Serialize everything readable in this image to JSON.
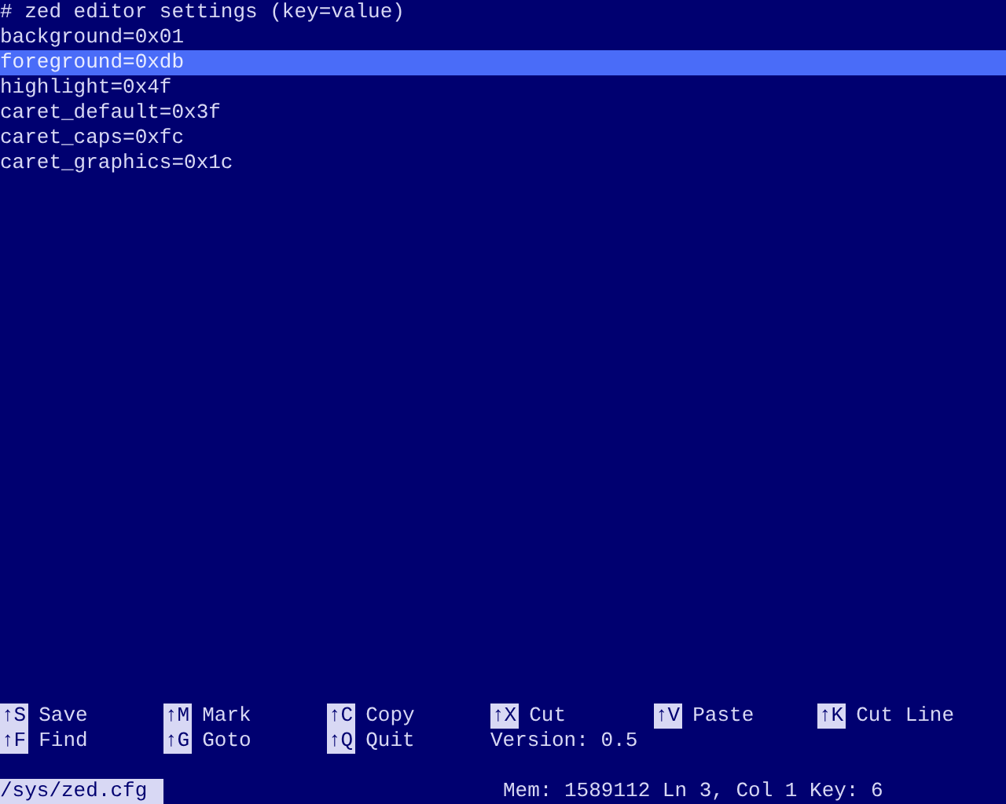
{
  "editor": {
    "lines": [
      {
        "text": "# zed editor settings (key=value)",
        "selected": false
      },
      {
        "text": "background=0x01",
        "selected": false
      },
      {
        "text": "foreground=0xdb",
        "selected": true
      },
      {
        "text": "highlight=0x4f",
        "selected": false
      },
      {
        "text": "caret_default=0x3f",
        "selected": false
      },
      {
        "text": "caret_caps=0xfc",
        "selected": false
      },
      {
        "text": "caret_graphics=0x1c",
        "selected": false
      }
    ]
  },
  "shortcuts": [
    [
      {
        "kind": "shortcut",
        "key": "↑S",
        "label": "Save"
      },
      {
        "kind": "shortcut",
        "key": "↑M",
        "label": "Mark"
      },
      {
        "kind": "shortcut",
        "key": "↑C",
        "label": "Copy"
      },
      {
        "kind": "shortcut",
        "key": "↑X",
        "label": "Cut"
      },
      {
        "kind": "shortcut",
        "key": "↑V",
        "label": "Paste"
      },
      {
        "kind": "shortcut",
        "key": "↑K",
        "label": "Cut Line"
      }
    ],
    [
      {
        "kind": "shortcut",
        "key": "↑F",
        "label": "Find"
      },
      {
        "kind": "shortcut",
        "key": "↑G",
        "label": "Goto"
      },
      {
        "kind": "shortcut",
        "key": "↑Q",
        "label": "Quit"
      },
      {
        "kind": "text",
        "label": "Version: 0.5"
      }
    ]
  ],
  "status_bar": {
    "file_path": "/sys/zed.cfg",
    "info": "Mem: 1589112 Ln 3, Col 1 Key: 6"
  }
}
